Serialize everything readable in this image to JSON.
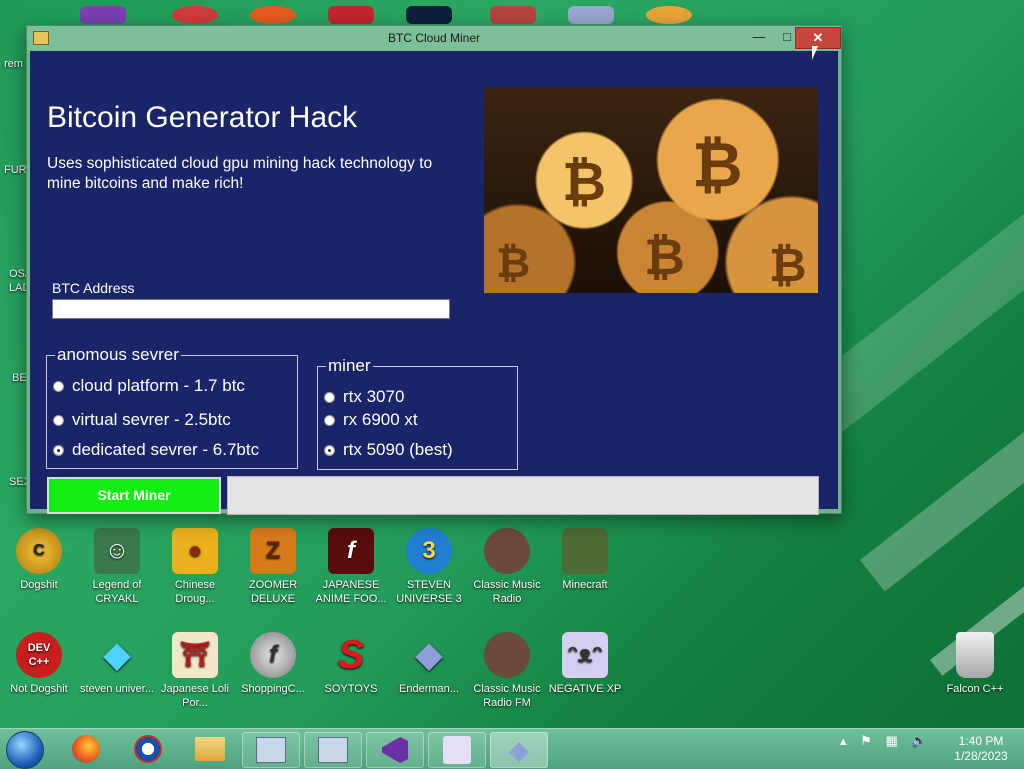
{
  "window": {
    "title": "BTC Cloud Miner",
    "min_glyph": "—",
    "max_glyph": "□",
    "close_glyph": "✕"
  },
  "app": {
    "heading": "Bitcoin Generator Hack",
    "description": "Uses sophisticated cloud gpu mining hack technology to mine bitcoins and make rich!",
    "address_label": "BTC Address",
    "address_value": "",
    "server_group": {
      "legend": "anomous sevrer",
      "options": [
        "cloud platform - 1.7 btc",
        "virtual sevrer - 2.5btc",
        "dedicated sevrer - 6.7btc"
      ],
      "selected_index": 2
    },
    "miner_group": {
      "legend": "miner",
      "options": [
        "rtx 3070",
        "rx 6900 xt",
        "rtx 5090 (best)"
      ],
      "selected_index": 2
    },
    "start_label": "Start Miner",
    "progress_fraction": 0
  },
  "desktop": {
    "edge_labels": [
      "rem",
      "FUR",
      "OSA",
      "LAD",
      "BE",
      "SEX"
    ],
    "row1": [
      {
        "name": "Dogshit"
      },
      {
        "name": "Legend of CRYAKL"
      },
      {
        "name": "Chinese Droug..."
      },
      {
        "name": "ZOOMER DELUXE"
      },
      {
        "name": "JAPANESE ANIME FOO..."
      },
      {
        "name": "STEVEN UNIVERSE 3"
      },
      {
        "name": "Classic Music Radio"
      },
      {
        "name": "Minecraft"
      }
    ],
    "row2": [
      {
        "name": "Not Dogshit"
      },
      {
        "name": "steven univer..."
      },
      {
        "name": "Japanese Loli Por..."
      },
      {
        "name": "ShoppingC..."
      },
      {
        "name": "SOYTOYS"
      },
      {
        "name": "Enderman..."
      },
      {
        "name": "Classic Music Radio FM"
      },
      {
        "name": "NEGATIVE XP"
      }
    ],
    "trash": {
      "name": "Falcon C++"
    }
  },
  "taskbar": {
    "time": "1:40 PM",
    "date": "1/28/2023"
  },
  "colors": {
    "client_bg": "#1a2468",
    "start_button": "#11ee11",
    "close_button": "#c7463b"
  }
}
